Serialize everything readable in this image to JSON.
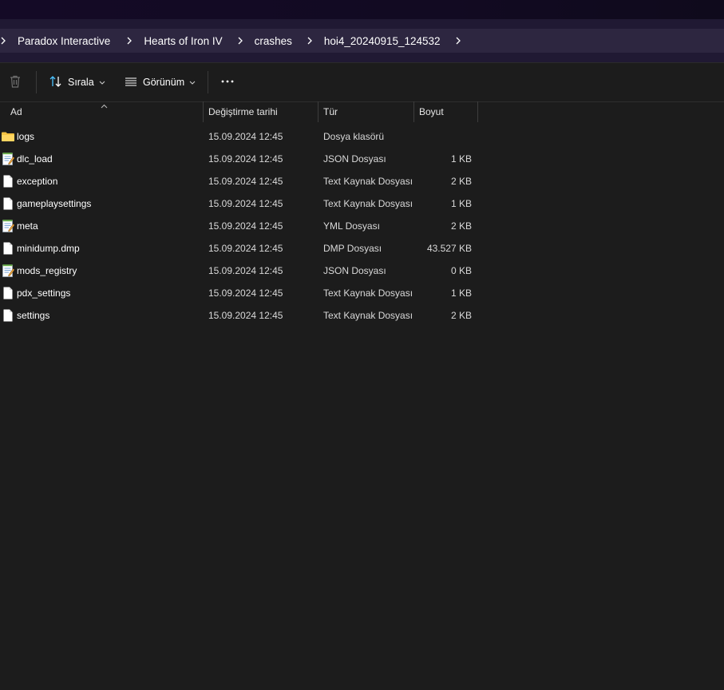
{
  "breadcrumb": {
    "items": [
      "Paradox Interactive",
      "Hearts of Iron IV",
      "crashes",
      "hoi4_20240915_124532"
    ]
  },
  "toolbar": {
    "sort_label": "Sırala",
    "view_label": "Görünüm"
  },
  "columns": {
    "name": "Ad",
    "date": "Değiştirme tarihi",
    "type": "Tür",
    "size": "Boyut"
  },
  "files": [
    {
      "name": "logs",
      "date": "15.09.2024 12:45",
      "type": "Dosya klasörü",
      "size": "",
      "icon": "folder-icon"
    },
    {
      "name": "dlc_load",
      "date": "15.09.2024 12:45",
      "type": "JSON Dosyası",
      "size": "1 KB",
      "icon": "notepad-file-icon"
    },
    {
      "name": "exception",
      "date": "15.09.2024 12:45",
      "type": "Text Kaynak Dosyası",
      "size": "2 KB",
      "icon": "file-icon"
    },
    {
      "name": "gameplaysettings",
      "date": "15.09.2024 12:45",
      "type": "Text Kaynak Dosyası",
      "size": "1 KB",
      "icon": "file-icon"
    },
    {
      "name": "meta",
      "date": "15.09.2024 12:45",
      "type": "YML Dosyası",
      "size": "2 KB",
      "icon": "notepad-file-icon"
    },
    {
      "name": "minidump.dmp",
      "date": "15.09.2024 12:45",
      "type": "DMP Dosyası",
      "size": "43.527 KB",
      "icon": "file-icon"
    },
    {
      "name": "mods_registry",
      "date": "15.09.2024 12:45",
      "type": "JSON Dosyası",
      "size": "0 KB",
      "icon": "notepad-file-icon"
    },
    {
      "name": "pdx_settings",
      "date": "15.09.2024 12:45",
      "type": "Text Kaynak Dosyası",
      "size": "1 KB",
      "icon": "file-icon"
    },
    {
      "name": "settings",
      "date": "15.09.2024 12:45",
      "type": "Text Kaynak Dosyası",
      "size": "2 KB",
      "icon": "file-icon"
    }
  ],
  "colors": {
    "background": "#1c1c1c",
    "address_bar": "#2d2640",
    "folder": "#f6c343",
    "accent": "#4cc2ff"
  }
}
